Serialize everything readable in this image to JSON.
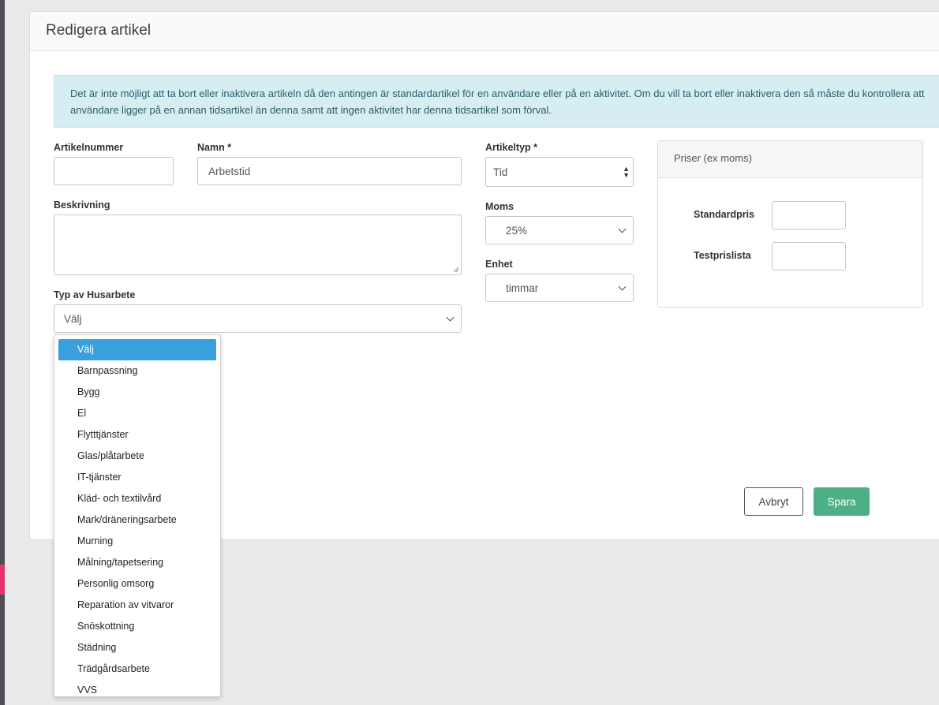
{
  "panel": {
    "title": "Redigera artikel"
  },
  "alert": {
    "line1": "Det är inte möjligt att ta bort eller inaktivera artikeln då den antingen är standardartikel för en användare eller på en aktivitet. Om du vill ta bort eller inaktivera den så måste du kontrollera att",
    "line2": "användare ligger på en annan tidsartikel än denna samt att ingen aktivitet har denna tidsartikel som förval."
  },
  "form": {
    "artikelnummer_label": "Artikelnummer",
    "artikelnummer_value": "",
    "namn_label": "Namn *",
    "namn_value": "Arbetstid",
    "artikeltyp_label": "Artikeltyp *",
    "artikeltyp_value": "Tid",
    "beskrivning_label": "Beskrivning",
    "moms_label": "Moms",
    "moms_value": "25%",
    "enhet_label": "Enhet",
    "enhet_value": "timmar",
    "husarbete_label": "Typ av Husarbete",
    "husarbete_value": "Välj"
  },
  "prices": {
    "title": "Priser (ex moms)",
    "standardpris_label": "Standardpris",
    "testprislista_label": "Testprislista"
  },
  "buttons": {
    "cancel": "Avbryt",
    "save": "Spara"
  },
  "dropdown": {
    "options": [
      "Välj",
      "Barnpassning",
      "Bygg",
      "El",
      "Flytttjänster",
      "Glas/plåtarbete",
      "IT-tjänster",
      "Kläd- och textilvård",
      "Mark/dräneringsarbete",
      "Murning",
      "Målning/tapetsering",
      "Personlig omsorg",
      "Reparation av vitvaror",
      "Snöskottning",
      "Städning",
      "Trädgårdsarbete",
      "VVS"
    ],
    "selected_index": 0
  },
  "colors": {
    "accent": "#e8336f",
    "save": "#4caf85",
    "selected": "#3a9fdd",
    "alert_bg": "#d6eef2"
  }
}
